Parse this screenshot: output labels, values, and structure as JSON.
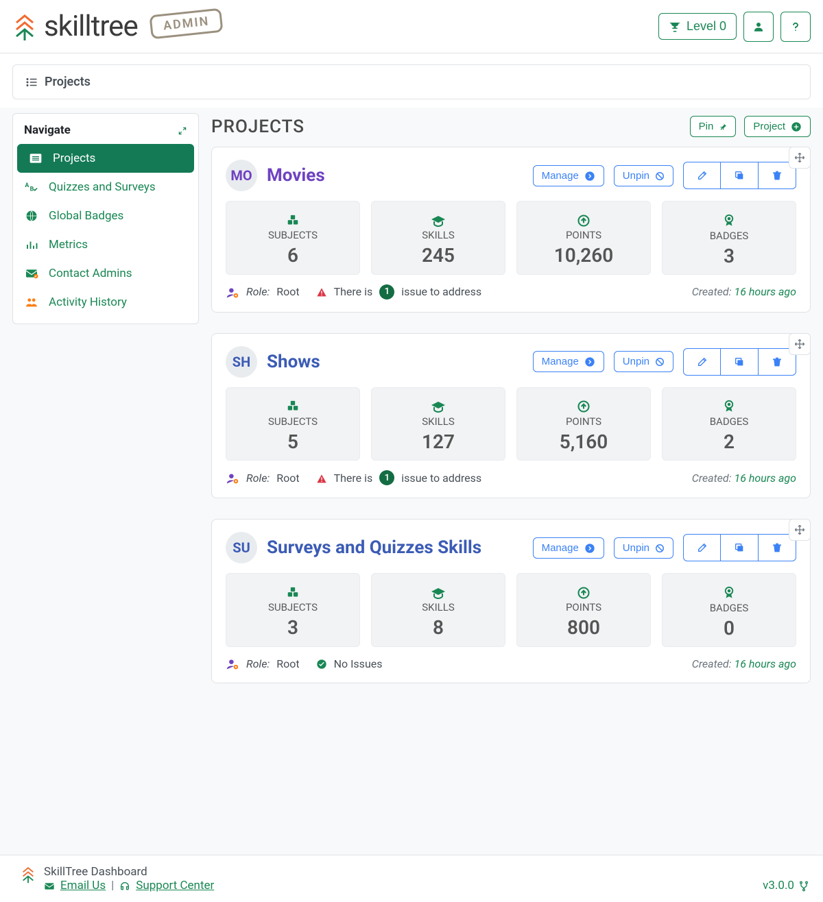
{
  "header": {
    "brand": "skilltree",
    "admin_stamp": "ADMIN",
    "level_label": "Level 0"
  },
  "breadcrumb": {
    "label": "Projects"
  },
  "sidebar": {
    "title": "Navigate",
    "items": [
      {
        "label": "Projects",
        "icon": "list",
        "active": true
      },
      {
        "label": "Quizzes and Surveys",
        "icon": "survey",
        "active": false
      },
      {
        "label": "Global Badges",
        "icon": "globe",
        "active": false
      },
      {
        "label": "Metrics",
        "icon": "chart",
        "active": false
      },
      {
        "label": "Contact Admins",
        "icon": "envelope",
        "active": false
      },
      {
        "label": "Activity History",
        "icon": "users",
        "active": false
      }
    ]
  },
  "page": {
    "title": "PROJECTS",
    "pin_label": "Pin",
    "project_label": "Project"
  },
  "buttons": {
    "manage": "Manage",
    "unpin": "Unpin"
  },
  "stat_labels": {
    "subjects": "SUBJECTS",
    "skills": "SKILLS",
    "points": "POINTS",
    "badges": "BADGES"
  },
  "projects": [
    {
      "initials": "MO",
      "name": "Movies",
      "color": "#6f42c1",
      "subjects": "6",
      "skills": "245",
      "points": "10,260",
      "badges": "3",
      "role": "Root",
      "issue_prefix": "There is",
      "issue_count": "1",
      "issue_suffix": "issue to address",
      "issues_ok": false,
      "created": "16 hours ago"
    },
    {
      "initials": "SH",
      "name": "Shows",
      "color": "#3b5bb5",
      "subjects": "5",
      "skills": "127",
      "points": "5,160",
      "badges": "2",
      "role": "Root",
      "issue_prefix": "There is",
      "issue_count": "1",
      "issue_suffix": "issue to address",
      "issues_ok": false,
      "created": "16 hours ago"
    },
    {
      "initials": "SU",
      "name": "Surveys and Quizzes Skills",
      "color": "#3b5bb5",
      "subjects": "3",
      "skills": "8",
      "points": "800",
      "badges": "0",
      "role": "Root",
      "issues_ok": true,
      "no_issues_label": "No Issues",
      "created": "16 hours ago"
    }
  ],
  "footer": {
    "title": "SkillTree Dashboard",
    "email_label": "Email Us",
    "support_label": "Support Center",
    "version": "v3.0.0",
    "separator": "|"
  },
  "labels": {
    "role_label": "Role:",
    "created_label": "Created:"
  }
}
